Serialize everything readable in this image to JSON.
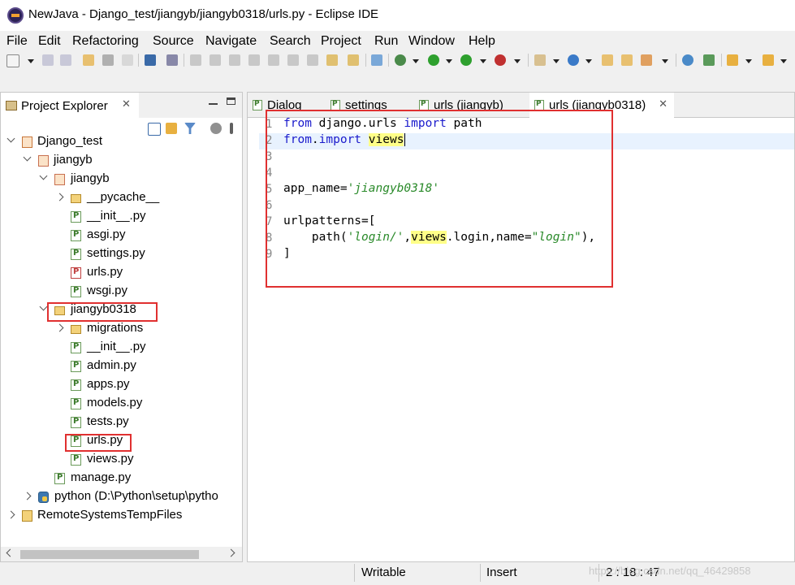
{
  "window": {
    "title": "NewJava - Django_test/jiangyb/jiangyb0318/urls.py - Eclipse IDE"
  },
  "menu": [
    "File",
    "Edit",
    "Refactoring",
    "Source",
    "Navigate",
    "Search",
    "Project",
    "Run",
    "Window",
    "Help"
  ],
  "explorer": {
    "tab_label": "Project Explorer",
    "tree": [
      {
        "label": "Django_test",
        "icon": "project-icon"
      },
      {
        "label": "jiangyb",
        "icon": "package-icon"
      },
      {
        "label": "jiangyb",
        "icon": "package-icon"
      },
      {
        "label": "__pycache__",
        "icon": "folder-icon"
      },
      {
        "label": "__init__.py",
        "icon": "python-file-icon"
      },
      {
        "label": "asgi.py",
        "icon": "python-file-icon"
      },
      {
        "label": "settings.py",
        "icon": "python-file-icon"
      },
      {
        "label": "urls.py",
        "icon": "python-file-error-icon"
      },
      {
        "label": "wsgi.py",
        "icon": "python-file-icon"
      },
      {
        "label": "jiangyb0318",
        "icon": "folder-icon"
      },
      {
        "label": "migrations",
        "icon": "folder-icon"
      },
      {
        "label": "__init__.py",
        "icon": "python-file-icon"
      },
      {
        "label": "admin.py",
        "icon": "python-file-icon"
      },
      {
        "label": "apps.py",
        "icon": "python-file-icon"
      },
      {
        "label": "models.py",
        "icon": "python-file-icon"
      },
      {
        "label": "tests.py",
        "icon": "python-file-icon"
      },
      {
        "label": "urls.py",
        "icon": "python-file-icon"
      },
      {
        "label": "views.py",
        "icon": "python-file-icon"
      },
      {
        "label": "manage.py",
        "icon": "python-file-icon"
      },
      {
        "label": "python  (D:\\Python\\setup\\pytho",
        "icon": "python-interpreter-icon"
      },
      {
        "label": "RemoteSystemsTempFiles",
        "icon": "folder-icon"
      }
    ]
  },
  "editor": {
    "tabs": [
      "Dialog",
      "settings",
      "urls (jiangyb)",
      "urls (jiangyb0318)"
    ],
    "line_numbers": [
      "1",
      "2",
      "3",
      "4",
      "5",
      "6",
      "7",
      "8",
      "9"
    ],
    "code": {
      "l1a": "from",
      "l1b": " django.urls ",
      "l1c": "import",
      "l1d": " path",
      "l2a": "from",
      "l2b": ".",
      "l2c": "import",
      "l2d": " ",
      "l2e": "views",
      "l5a": "app_name=",
      "l5b": "'jiangyb0318'",
      "l7": "urlpatterns=[",
      "l8a": "    path(",
      "l8b": "'login/'",
      "l8c": ",",
      "l8d": "views",
      "l8e": ".login,name=",
      "l8f": "\"login\"",
      "l8g": "),",
      "l9": "]"
    }
  },
  "status": {
    "mode": "Writable",
    "insert": "Insert",
    "position": "2 : 18 : 47",
    "watermark": "https://blog.csdn.net/qq_46429858"
  }
}
